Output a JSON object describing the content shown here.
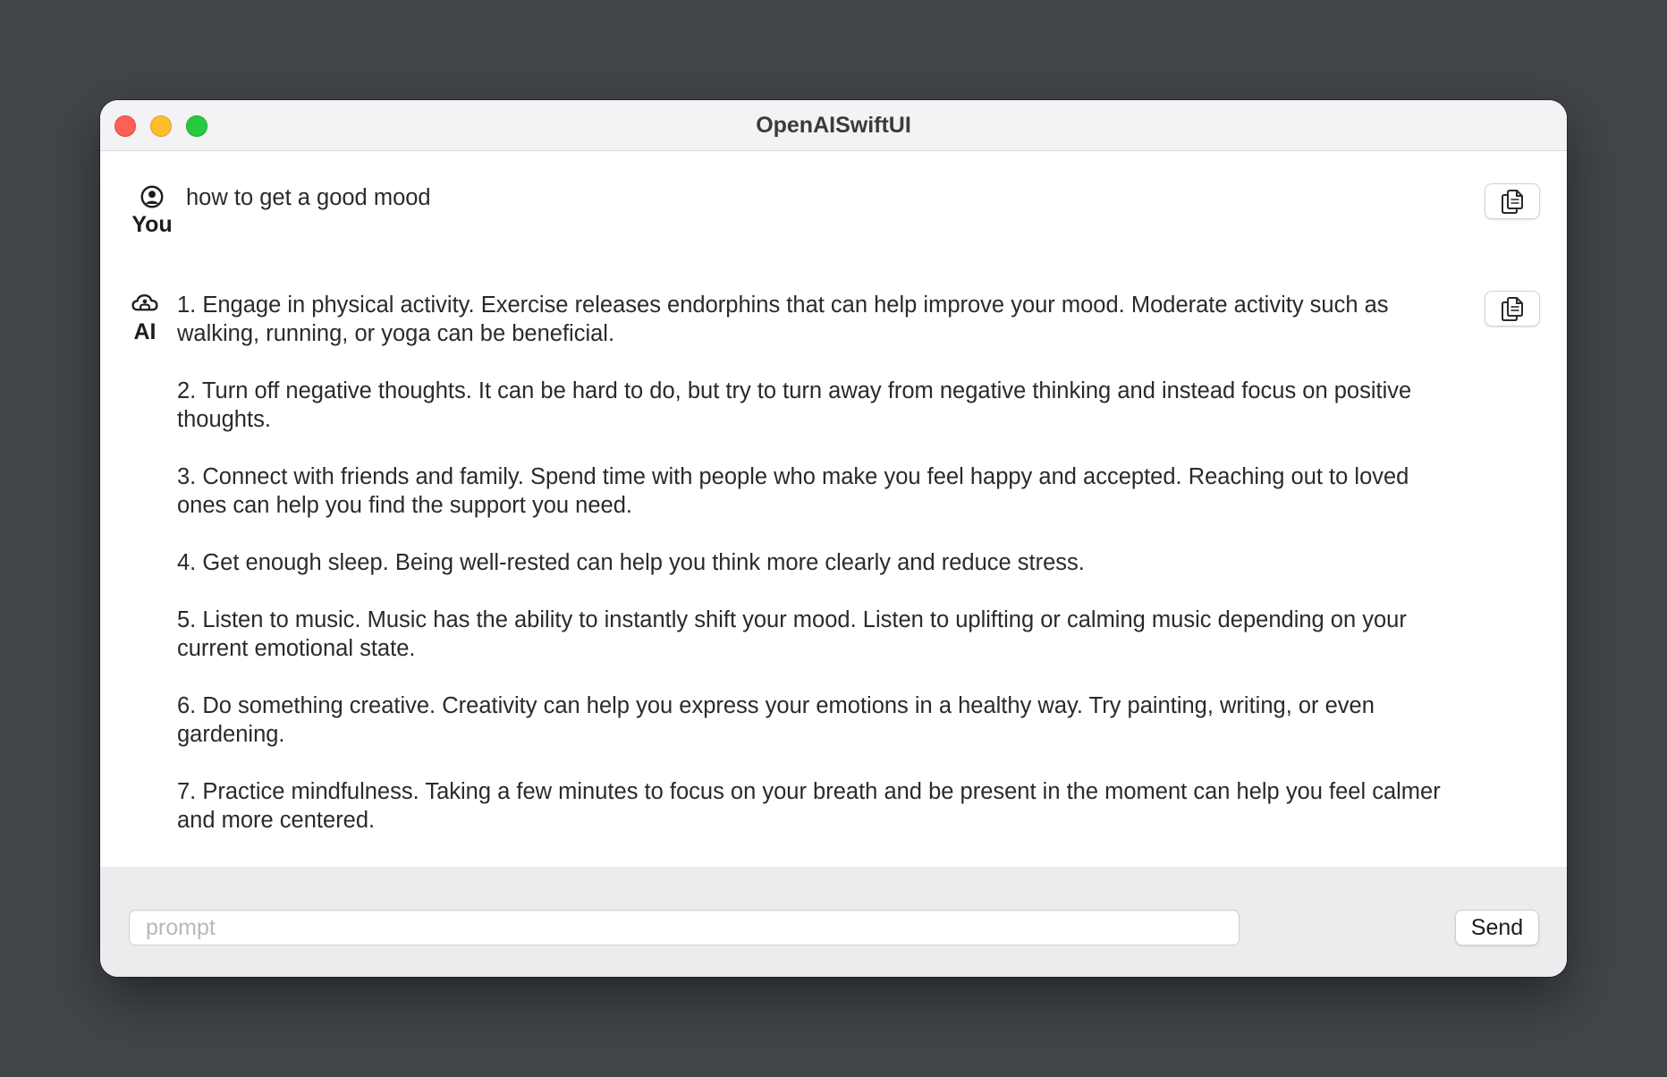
{
  "window": {
    "title": "OpenAISwiftUI"
  },
  "icons": {
    "user_avatar": "person-circle-icon",
    "ai_avatar": "cloud-icon",
    "copy": "copy-icon"
  },
  "messages": {
    "user": {
      "label": "You",
      "text": "how to get a good mood"
    },
    "ai": {
      "label": "AI",
      "paragraphs": [
        "1. Engage in physical activity. Exercise releases endorphins that can help improve your mood. Moderate activity such as walking, running, or yoga can be beneficial.",
        "2. Turn off negative thoughts. It can be hard to do, but try to turn away from negative thinking and instead focus on positive thoughts.",
        "3. Connect with friends and family. Spend time with people who make you feel happy and accepted. Reaching out to loved ones can help you find the support you need.",
        "4. Get enough sleep. Being well-rested can help you think more clearly and reduce stress.",
        "5. Listen to music. Music has the ability to instantly shift your mood. Listen to uplifting or calming music depending on your current emotional state.",
        "6. Do something creative. Creativity can help you express your emotions in a healthy way. Try painting, writing, or even gardening.",
        "7. Practice mindfulness. Taking a few minutes to focus on your breath and be present in the moment can help you feel calmer and more centered."
      ]
    }
  },
  "input": {
    "placeholder": "prompt",
    "value": ""
  },
  "send_button": {
    "label": "Send"
  },
  "colors": {
    "desktop": "#42464b",
    "titlebar": "#f3f2f4",
    "footer": "#ececee",
    "close": "#fe5f57",
    "minimize": "#febc2e",
    "zoom": "#28c840"
  }
}
